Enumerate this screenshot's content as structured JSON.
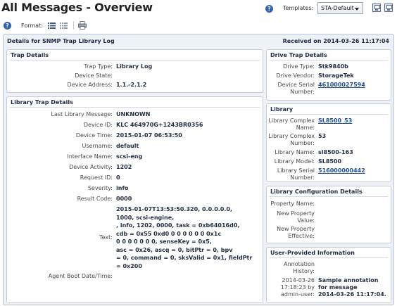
{
  "header": {
    "title": "All Messages - Overview",
    "templates_label": "Templates:",
    "template_value": "STA-Default"
  },
  "toolbar": {
    "format_label": "Format:"
  },
  "main": {
    "title": "Details for SNMP Trap Library Log",
    "received": "Received on 2014-03-26 11:17:04"
  },
  "trap_details": {
    "title": "Trap Details",
    "trap_type_label": "Trap Type:",
    "trap_type": "Library Log",
    "device_state_label": "Device State:",
    "device_state": "",
    "device_address_label": "Device Address:",
    "device_address": "1.1.-2.1.2"
  },
  "library_trap": {
    "title": "Library Trap Details",
    "last_msg_label": "Last Library Message:",
    "last_msg": "UNKNOWN",
    "device_id_label": "Device ID:",
    "device_id": "KLC 464970G+1243BR0356",
    "device_time_label": "Device Time:",
    "device_time": "2015-01-07 06:53:50",
    "username_label": "Username:",
    "username": "default",
    "interface_label": "Interface Name:",
    "interface": "scsi-eng",
    "activity_label": "Device Activity:",
    "activity": "1202",
    "request_label": "Request ID:",
    "request": "0",
    "severity_label": "Severity:",
    "severity": "info",
    "result_label": "Result Code:",
    "result": "0000",
    "text_label": "Text:",
    "text_lines": [
      "2015-01-07T13:53:50.320, 0.0.0.0.0,",
      "1000, scsi-engine,",
      ", info, 1202, 0000, task = 0xb64016d0,",
      "cdb = 0x55 0xd0 0 0 0 0 0 0 0x1c",
      "0 0 0 0 0 0 0, senseKey = 0x5,",
      "asc = 0x26, ascq = 0, bitPtr = 0, bpv",
      "= 0, command = 0, sksValid = 0x1, fieldPtr",
      "= 0x200"
    ],
    "agent_boot_label": "Agent Boot Date/Time:",
    "agent_boot": ""
  },
  "drive_trap": {
    "title": "Drive Trap Details",
    "drive_type_label": "Drive Type:",
    "drive_type": "Stk9840b",
    "drive_vendor_label": "Drive Vendor:",
    "drive_vendor": "StorageTek",
    "serial_label_1": "Device Serial",
    "serial_label_2": "Number:",
    "serial": "461000027594"
  },
  "library": {
    "title": "Library",
    "complex_name_label_1": "Library Complex",
    "complex_name_label_2": "Name:",
    "complex_name": "SL8500_53",
    "complex_number_label_1": "Library Complex",
    "complex_number_label_2": "Number:",
    "complex_number": "53",
    "lib_name_label": "Library Name:",
    "lib_name": "sl8500-163",
    "lib_model_label": "Library Model:",
    "lib_model": "SL8500",
    "lib_serial_label_1": "Library Serial",
    "lib_serial_label_2": "Number:",
    "lib_serial": "516000000442"
  },
  "lib_config": {
    "title": "Library Configuration Details",
    "prop_name_label": "Property Name:",
    "new_value_label_1": "New Property",
    "new_value_label_2": "Value:",
    "new_eff_label_1": "New Property",
    "new_eff_label_2": "Effective:"
  },
  "user_info": {
    "title": "User-Provided Information",
    "history_label_1": "Annotation",
    "history_label_2": "History:",
    "entry_date": "2014-03-26",
    "entry_time_by": "17:18:23 by",
    "entry_user": "admin-user:",
    "entry_text_lines": [
      "Sample annotation",
      "for message",
      "2014-03-26 11:17:04."
    ]
  },
  "icons": [
    "help-icon",
    "save-icon",
    "save-as-icon",
    "list-format-icon",
    "columns-format-icon",
    "print-icon"
  ],
  "colors": {
    "title_text": "#1c2b45",
    "link": "#1d4f9c",
    "panel_bg": "#eef2f7",
    "help_icon": "#2d63b8"
  }
}
